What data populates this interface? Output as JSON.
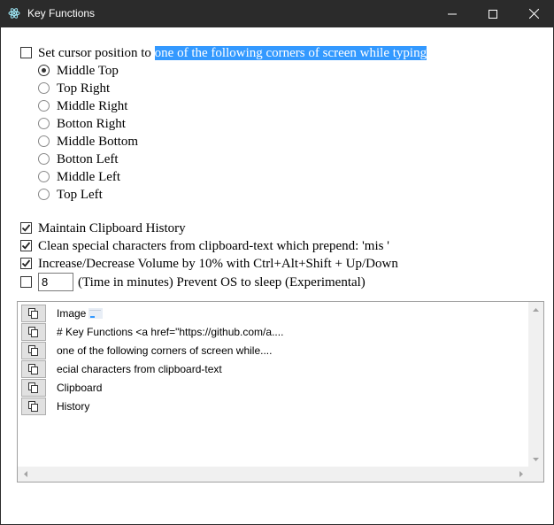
{
  "window": {
    "title": "Key Functions",
    "icon": "electron-icon"
  },
  "settings": {
    "cursor": {
      "label_prefix": "Set cursor position to ",
      "label_highlight": "one of the following corners of screen while typing",
      "checked": false,
      "options": [
        "Middle Top",
        "Top Right",
        "Middle Right",
        "Botton Right",
        "Middle Bottom",
        "Botton Left",
        "Middle Left",
        "Top Left"
      ],
      "selected": "Middle Top"
    },
    "clipboard_history": {
      "label": "Maintain Clipboard History",
      "checked": true
    },
    "clean_chars": {
      "label": "Clean special characters from clipboard-text which prepend: 'mis '",
      "checked": true
    },
    "volume": {
      "label": "Increase/Decrease Volume by 10% with Ctrl+Alt+Shift + Up/Down",
      "checked": true
    },
    "prevent_sleep": {
      "value": "8",
      "label": "(Time in minutes) Prevent OS to sleep (Experimental)",
      "checked": false
    }
  },
  "history": {
    "items": [
      "Image",
      "# Key Functions <a href=\"https://github.com/a....",
      "one of the following corners of screen while....",
      "ecial characters from clipboard-text",
      "Clipboard",
      "History"
    ]
  },
  "colors": {
    "titlebar": "#2b2b2b",
    "highlight": "#3399ff"
  }
}
